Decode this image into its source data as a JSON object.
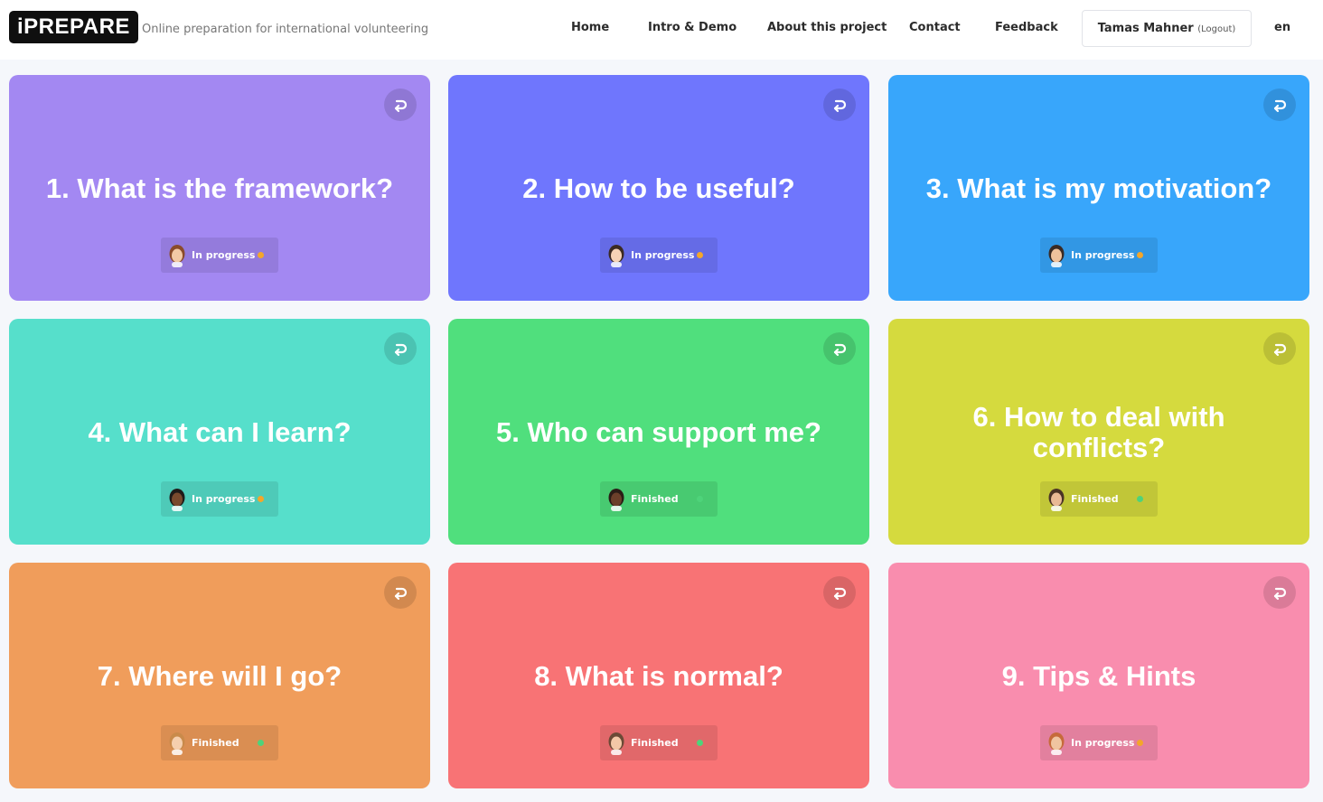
{
  "header": {
    "logo": "iPREPARE",
    "tagline": "Online preparation for international volunteering",
    "nav": [
      "Home",
      "Intro & Demo",
      "About this project",
      "Contact",
      "Feedback"
    ],
    "user_name": "Tamas Mahner",
    "logout_label": "(Logout)",
    "language": "en"
  },
  "colors": {
    "in_progress_dot": "#f4a62a",
    "finished_dot": "#4ed37a"
  },
  "cards": [
    {
      "title": "1. What is the framework?",
      "status": "In progress",
      "color": "#a388f2",
      "icon": "replay-icon",
      "avatar": "avatar-woman-long-hair"
    },
    {
      "title": "2. How to be useful?",
      "status": "In progress",
      "color": "#6f76fd",
      "icon": "replay-icon",
      "avatar": "avatar-man-short-hair"
    },
    {
      "title": "3. What is my motivation?",
      "status": "In progress",
      "color": "#38a6fb",
      "icon": "replay-icon",
      "avatar": "avatar-woman-curly-hair"
    },
    {
      "title": "4. What can I learn?",
      "status": "In progress",
      "color": "#56dfcb",
      "icon": "replay-icon",
      "avatar": "avatar-man-dark-skin"
    },
    {
      "title": "5. Who can support me?",
      "status": "Finished",
      "color": "#50df7d",
      "icon": "replay-icon",
      "avatar": "avatar-woman-dark-skin"
    },
    {
      "title": "6. How to deal with conflicts?",
      "status": "Finished",
      "color": "#d5da3e",
      "icon": "replay-icon",
      "avatar": "avatar-man-beard"
    },
    {
      "title": "7. Where will I go?",
      "status": "Finished",
      "color": "#f09d5b",
      "icon": "replay-icon",
      "avatar": "avatar-woman-blonde"
    },
    {
      "title": "8. What is normal?",
      "status": "Finished",
      "color": "#f87375",
      "icon": "replay-icon",
      "avatar": "avatar-man-curly-hair"
    },
    {
      "title": "9. Tips & Hints",
      "status": "In progress",
      "color": "#f98dae",
      "icon": "replay-icon",
      "avatar": "avatar-woman-red-hair"
    }
  ]
}
